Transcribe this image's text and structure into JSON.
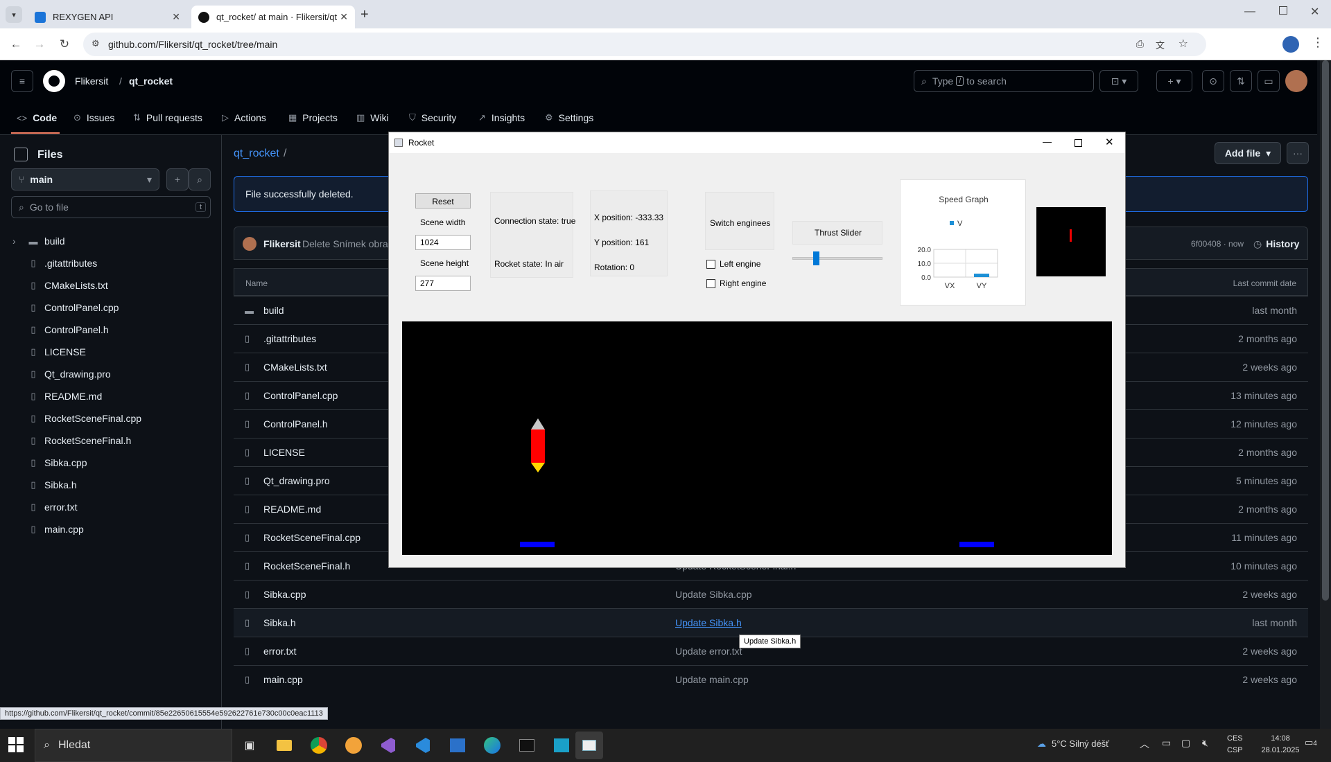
{
  "browser": {
    "tabs": [
      {
        "title": "REXYGEN API"
      },
      {
        "title": "qt_rocket/ at main · Flikersit/qt..."
      }
    ],
    "url": "github.com/Flikersit/qt_rocket/tree/main",
    "status_url": "https://github.com/Flikersit/qt_rocket/commit/85e22650615554e592622761e730c00c0eac1113"
  },
  "github": {
    "owner": "Flikersit",
    "repo": "qt_rocket",
    "search_placeholder_pre": "Type",
    "search_key": "/",
    "search_placeholder_post": "to search",
    "nav": [
      {
        "label": "Code"
      },
      {
        "label": "Issues"
      },
      {
        "label": "Pull requests"
      },
      {
        "label": "Actions"
      },
      {
        "label": "Projects"
      },
      {
        "label": "Wiki"
      },
      {
        "label": "Security"
      },
      {
        "label": "Insights"
      },
      {
        "label": "Settings"
      }
    ],
    "sidebar": {
      "title": "Files",
      "branch": "main",
      "goto_placeholder": "Go to file",
      "goto_key": "t",
      "items": [
        {
          "name": "build",
          "type": "folder"
        },
        {
          "name": ".gitattributes",
          "type": "file"
        },
        {
          "name": "CMakeLists.txt",
          "type": "file"
        },
        {
          "name": "ControlPanel.cpp",
          "type": "file"
        },
        {
          "name": "ControlPanel.h",
          "type": "file"
        },
        {
          "name": "LICENSE",
          "type": "file"
        },
        {
          "name": "Qt_drawing.pro",
          "type": "file"
        },
        {
          "name": "README.md",
          "type": "file"
        },
        {
          "name": "RocketSceneFinal.cpp",
          "type": "file"
        },
        {
          "name": "RocketSceneFinal.h",
          "type": "file"
        },
        {
          "name": "Sibka.cpp",
          "type": "file"
        },
        {
          "name": "Sibka.h",
          "type": "file"
        },
        {
          "name": "error.txt",
          "type": "file"
        },
        {
          "name": "main.cpp",
          "type": "file"
        }
      ]
    },
    "breadcrumb_repo": "qt_rocket",
    "breadcrumb_sep": "/",
    "add_file": "Add file",
    "flash": "File successfully deleted.",
    "commit": {
      "author": "Flikersit",
      "message": "Delete Snímek obraz",
      "sha_time": "6f00408 · now",
      "history": "History"
    },
    "table_headers": {
      "name": "Name",
      "last_commit_date": "Last commit date"
    },
    "files": [
      {
        "name": "build",
        "type": "folder",
        "msg": "",
        "date": "last month"
      },
      {
        "name": ".gitattributes",
        "type": "file",
        "msg": "",
        "date": "2 months ago"
      },
      {
        "name": "CMakeLists.txt",
        "type": "file",
        "msg": "",
        "date": "2 weeks ago"
      },
      {
        "name": "ControlPanel.cpp",
        "type": "file",
        "msg": "",
        "date": "13 minutes ago"
      },
      {
        "name": "ControlPanel.h",
        "type": "file",
        "msg": "",
        "date": "12 minutes ago"
      },
      {
        "name": "LICENSE",
        "type": "file",
        "msg": "",
        "date": "2 months ago"
      },
      {
        "name": "Qt_drawing.pro",
        "type": "file",
        "msg": "",
        "date": "5 minutes ago"
      },
      {
        "name": "README.md",
        "type": "file",
        "msg": "",
        "date": "2 months ago"
      },
      {
        "name": "RocketSceneFinal.cpp",
        "type": "file",
        "msg": "",
        "date": "11 minutes ago"
      },
      {
        "name": "RocketSceneFinal.h",
        "type": "file",
        "msg": "Update RocketSceneFinal.h",
        "date": "10 minutes ago"
      },
      {
        "name": "Sibka.cpp",
        "type": "file",
        "msg": "Update Sibka.cpp",
        "date": "2 weeks ago"
      },
      {
        "name": "Sibka.h",
        "type": "file",
        "msg": "Update Sibka.h",
        "date": "last month"
      },
      {
        "name": "error.txt",
        "type": "file",
        "msg": "Update error.txt",
        "date": "2 weeks ago"
      },
      {
        "name": "main.cpp",
        "type": "file",
        "msg": "Update main.cpp",
        "date": "2 weeks ago"
      }
    ],
    "tooltip": "Update Sibka.h"
  },
  "rocket_app": {
    "title": "Rocket",
    "reset": "Reset",
    "scene_width_label": "Scene width",
    "scene_width": "1024",
    "scene_height_label": "Scene height",
    "scene_height": "277",
    "connection_state": "Connection state: true",
    "rocket_state": "Rocket state: In air",
    "x_position": "X position: -333.33",
    "y_position": "Y position: 161",
    "rotation": "Rotation: 0",
    "switch_engines": "Switch enginees",
    "left_engine": "Left engine",
    "right_engine": "Right engine",
    "left_engine_checked": false,
    "right_engine_checked": false,
    "thrust_label": "Thrust Slider",
    "thrust_value": 0.25,
    "colors": {
      "rocket": "#ff0000",
      "pad": "#0000ff",
      "nozzle": "#ffd700",
      "scene": "#000000"
    }
  },
  "chart_data": {
    "type": "bar",
    "title": "Speed Graph",
    "categories": [
      "VX",
      "VY"
    ],
    "series": [
      {
        "name": "V",
        "values": [
          0,
          2.5
        ],
        "color": "#1e90d6"
      }
    ],
    "yticks": [
      "0.0",
      "10.0",
      "20.0"
    ],
    "ylim": [
      0,
      20
    ],
    "legend": "top"
  },
  "taskbar": {
    "search": "Hledat",
    "weather": "5°C  Silný déšť",
    "lang": "CES",
    "layout": "CSP",
    "time": "14:08",
    "date": "28.01.2025",
    "notifications": "4"
  }
}
